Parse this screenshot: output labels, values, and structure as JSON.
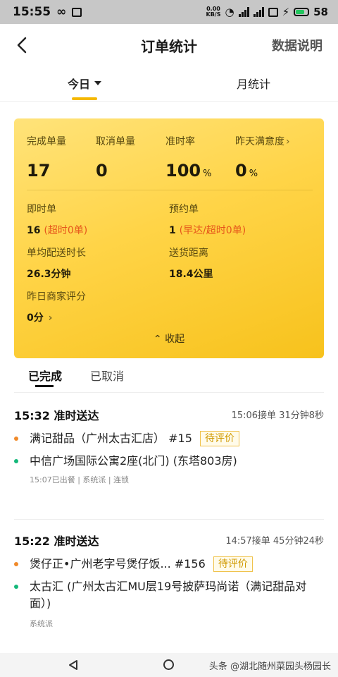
{
  "status_bar": {
    "time": "15:55",
    "net_speed_top": "0.00",
    "net_speed_bottom": "KB/S",
    "battery": "58"
  },
  "header": {
    "title": "订单统计",
    "help_label": "数据说明"
  },
  "period_tabs": [
    {
      "label": "今日",
      "active": true
    },
    {
      "label": "月统计",
      "active": false
    }
  ],
  "stats": {
    "metrics": [
      {
        "label": "完成单量",
        "value": "17",
        "unit": ""
      },
      {
        "label": "取消单量",
        "value": "0",
        "unit": ""
      },
      {
        "label": "准时率",
        "value": "100",
        "unit": "%"
      },
      {
        "label": "昨天满意度",
        "value": "0",
        "unit": "%"
      }
    ],
    "instant_label": "即时单",
    "instant_count": "16",
    "instant_note": "(超时0单)",
    "reserve_label": "预约单",
    "reserve_count": "1",
    "reserve_note": "(早达/超时0单)",
    "avg_time_label": "单均配送时长",
    "avg_time_value": "26.3分钟",
    "distance_label": "送货距离",
    "distance_value": "18.4公里",
    "merchant_label": "昨日商家评分",
    "merchant_value": "0分",
    "collapse_label": "收起"
  },
  "order_tabs": [
    {
      "label": "已完成",
      "active": true
    },
    {
      "label": "已取消",
      "active": false
    }
  ],
  "orders": [
    {
      "title": "15:32 准时送达",
      "meta": "15:06接单 31分钟8秒",
      "shop": "满记甜品（广州太古汇店）",
      "number": "#15",
      "status": "待评价",
      "address": "中信广场国际公寓2座(北门) (东塔803房)",
      "tags": "15:07已出餐 | 系统派 | 连锁"
    },
    {
      "title": "15:22 准时送达",
      "meta": "14:57接单 45分钟24秒",
      "shop": "煲仔正•广州老字号煲仔饭...",
      "number": "#156",
      "status": "待评价",
      "address_line1": "太古汇 (广州太古汇MU层19号披萨玛尚诺（满记甜品对",
      "address_line2": "面）)",
      "tags": "系统派"
    }
  ],
  "watermark": "头条 @湖北随州菜园头杨园长"
}
